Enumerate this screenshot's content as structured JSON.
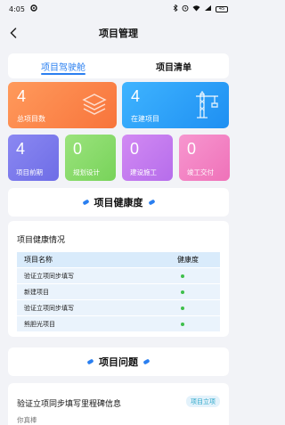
{
  "status_bar": {
    "time": "4:05",
    "battery": "45"
  },
  "header": {
    "title": "项目管理"
  },
  "tabs": [
    {
      "label": "项目驾驶舱",
      "active": true
    },
    {
      "label": "项目清单",
      "active": false
    }
  ],
  "stats_big": [
    {
      "value": "4",
      "label": "总项目数",
      "icon": "layers-icon"
    },
    {
      "value": "4",
      "label": "在建项目",
      "icon": "crane-icon"
    }
  ],
  "stats_small": [
    {
      "value": "4",
      "label": "项目前期"
    },
    {
      "value": "0",
      "label": "规划设计"
    },
    {
      "value": "0",
      "label": "建设施工"
    },
    {
      "value": "0",
      "label": "竣工交付"
    }
  ],
  "health_section": {
    "heading": "项目健康度",
    "card_title": "项目健康情况",
    "columns": [
      "项目名称",
      "健康度"
    ],
    "rows": [
      {
        "name": "验证立项同步填写",
        "status_color": "#3fbf4b"
      },
      {
        "name": "新建项目",
        "status_color": "#3fbf4b"
      },
      {
        "name": "验证立项同步填写",
        "status_color": "#3fbf4b"
      },
      {
        "name": "熊胆光项目",
        "status_color": "#3fbf4b"
      }
    ]
  },
  "issue_section": {
    "heading": "项目问题",
    "item": {
      "title": "验证立项同步填写里程碑信息",
      "tag": "项目立项",
      "user": "你真棒"
    }
  },
  "colors": {
    "accent": "#2a7ff0",
    "health_green": "#3fbf4b"
  }
}
